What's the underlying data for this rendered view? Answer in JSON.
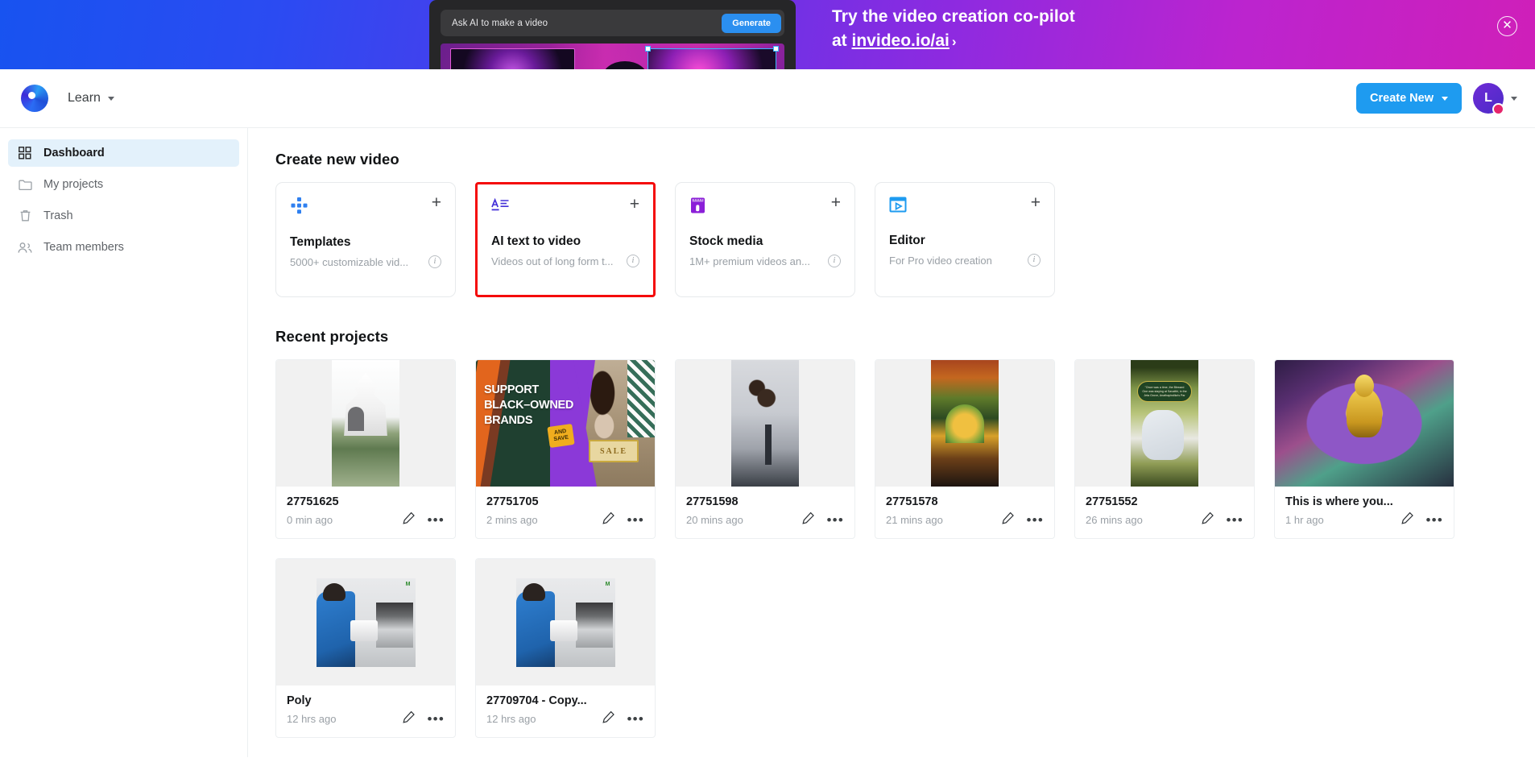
{
  "promo": {
    "prompt_placeholder": "Ask AI to make a video",
    "generate_label": "Generate",
    "line1": "Try the video creation co-pilot",
    "line2_prefix": "at ",
    "link_text": "invideo.io/ai",
    "chevron": "›",
    "close_icon": "✕"
  },
  "appbar": {
    "workspace_label": "Learn",
    "create_new_label": "Create New",
    "avatar_initial": "L"
  },
  "sidebar": {
    "items": [
      {
        "label": "Dashboard",
        "icon": "grid-icon",
        "active": true
      },
      {
        "label": "My projects",
        "icon": "folder-icon",
        "active": false
      },
      {
        "label": "Trash",
        "icon": "trash-icon",
        "active": false
      },
      {
        "label": "Team members",
        "icon": "people-icon",
        "active": false
      }
    ]
  },
  "create_section": {
    "title": "Create new video",
    "plus_icon": "+",
    "info_icon": "i",
    "cards": [
      {
        "title": "Templates",
        "subtitle": "5000+ customizable vid...",
        "icon": "templates-icon",
        "highlighted": false
      },
      {
        "title": "AI text to video",
        "subtitle": "Videos out of long form t...",
        "icon": "text-to-video-icon",
        "highlighted": true
      },
      {
        "title": "Stock media",
        "subtitle": "1M+ premium videos an...",
        "icon": "stock-media-icon",
        "highlighted": false
      },
      {
        "title": "Editor",
        "subtitle": "For Pro video creation",
        "icon": "editor-icon",
        "highlighted": false
      }
    ]
  },
  "recent_section": {
    "title": "Recent projects",
    "edit_icon": "✎",
    "more_icon": "•••",
    "projects": [
      {
        "title": "27751625",
        "time": "0 min ago",
        "thumb": "temple"
      },
      {
        "title": "27751705",
        "time": "2 mins ago",
        "thumb": "support-black-owned"
      },
      {
        "title": "27751598",
        "time": "20 mins ago",
        "thumb": "people"
      },
      {
        "title": "27751578",
        "time": "21 mins ago",
        "thumb": "shrine"
      },
      {
        "title": "27751552",
        "time": "26 mins ago",
        "thumb": "quote"
      },
      {
        "title": "This is where you...",
        "time": "1 hr ago",
        "thumb": "buddha"
      },
      {
        "title": "Poly",
        "time": "12 hrs ago",
        "thumb": "factory"
      },
      {
        "title": "27709704 - Copy...",
        "time": "12 hrs ago",
        "thumb": "factory"
      }
    ]
  },
  "thumb_text": {
    "support_line1": "SUPPORT",
    "support_line2": "BLACK–OWNED",
    "support_line3": "BRANDS",
    "support_tag_line1": "AND",
    "support_tag_line2": "SAVE",
    "support_sale": "SALE",
    "quote_text": "\"Once was a time, the Blessed One was staying at Savatthi, in the Jeta Grove, Anathapindika's Par",
    "factory_logo": "M"
  },
  "colors": {
    "accent_blue": "#1e9bf0",
    "highlight_red": "#f40b0b",
    "sidebar_active_bg": "#e3f1fb"
  }
}
